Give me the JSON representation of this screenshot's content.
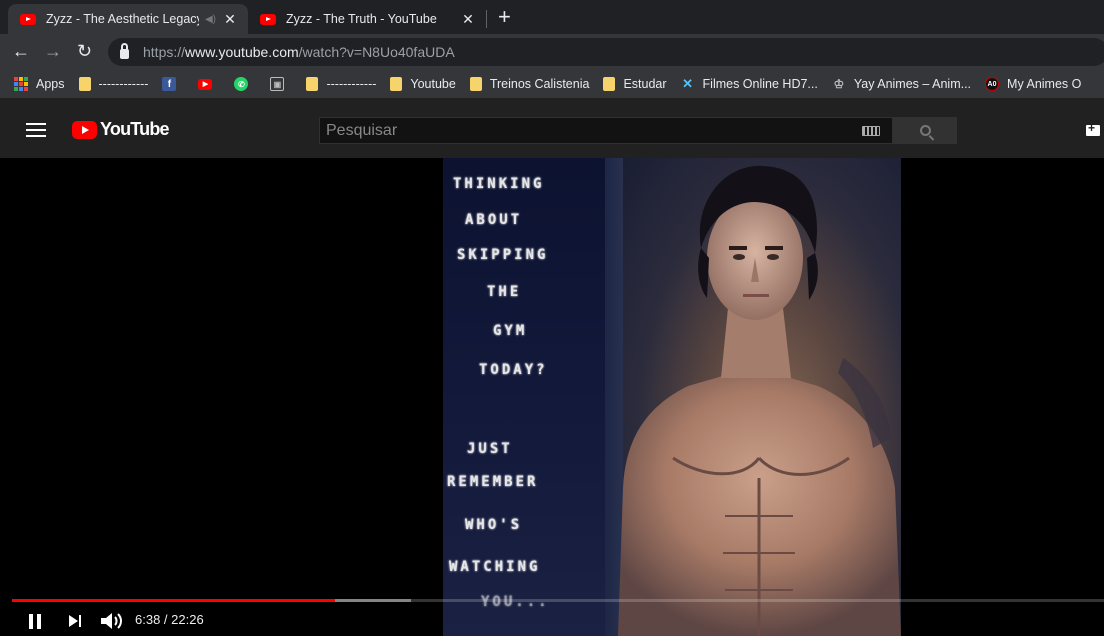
{
  "browser": {
    "tabs": [
      {
        "title": "Zyzz - The Aesthetic Legacy",
        "active": true,
        "audio_icon": "speaker-icon"
      },
      {
        "title": "Zyzz - The Truth - YouTube",
        "active": false
      }
    ],
    "close_glyph": "✕",
    "new_tab_glyph": "+",
    "nav": {
      "back": "←",
      "forward": "→",
      "reload": "↻"
    },
    "url": {
      "scheme": "https://",
      "host": "www.youtube.com",
      "path": "/watch?v=N8Uo40faUDA"
    },
    "bookmarks": [
      {
        "label": "Apps",
        "icon": "apps-grid-icon"
      },
      {
        "label": "------------",
        "icon": "folder-icon"
      },
      {
        "label": "",
        "icon": "facebook-icon"
      },
      {
        "label": "",
        "icon": "youtube-icon"
      },
      {
        "label": "",
        "icon": "whatsapp-icon"
      },
      {
        "label": "",
        "icon": "image-icon"
      },
      {
        "label": "------------",
        "icon": "folder-icon"
      },
      {
        "label": "Youtube",
        "icon": "folder-icon"
      },
      {
        "label": "Treinos Calistenia",
        "icon": "folder-icon"
      },
      {
        "label": "Estudar",
        "icon": "folder-icon"
      },
      {
        "label": "Filmes Online HD7...",
        "icon": "x-icon"
      },
      {
        "label": "Yay Animes – Anim...",
        "icon": "yay-icon"
      },
      {
        "label": "My Animes O",
        "icon": "myanimes-icon"
      }
    ]
  },
  "youtube": {
    "logo_text": "YouTube",
    "search_placeholder": "Pesquisar",
    "colors": {
      "brand": "#ff0000",
      "header_bg": "#212121"
    }
  },
  "player": {
    "motto_lines": [
      "THINKING",
      "ABOUT",
      "SKIPPING",
      "THE",
      "GYM",
      "TODAY?",
      "JUST",
      "REMEMBER",
      "WHO'S",
      "WATCHING",
      "YOU..."
    ],
    "current_time": "6:38",
    "duration": "22:26",
    "time_separator": " / ",
    "played_fraction": 0.2957,
    "buffered_fraction": 0.3655
  }
}
